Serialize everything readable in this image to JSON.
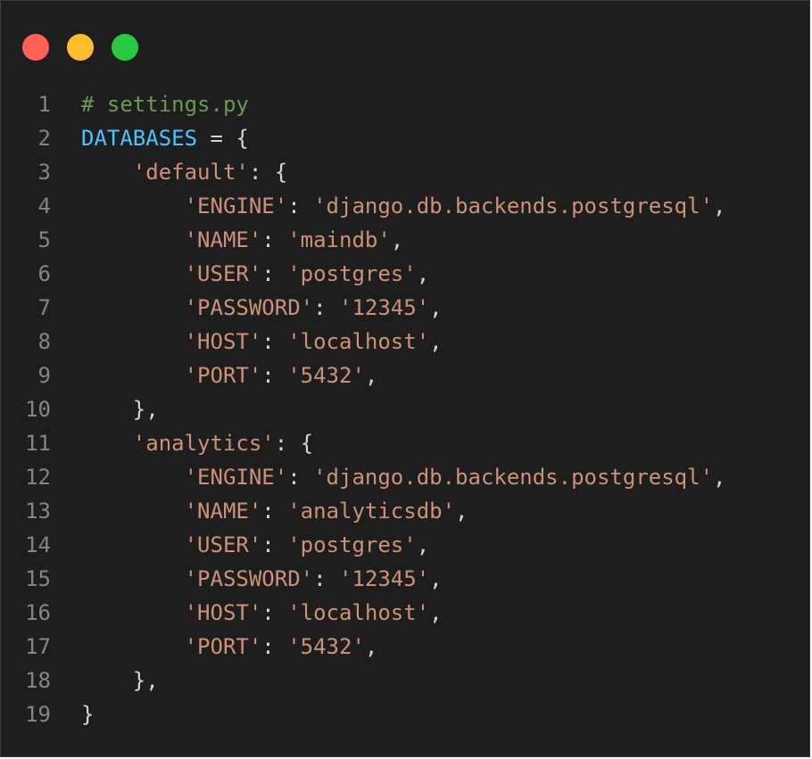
{
  "window": {
    "dots": [
      {
        "name": "close-dot",
        "color": "#ff5f57"
      },
      {
        "name": "minimize-dot",
        "color": "#febc2e"
      },
      {
        "name": "maximize-dot",
        "color": "#28c840"
      }
    ]
  },
  "colors": {
    "background": "#1e1e1e",
    "line_number": "#858585",
    "comment": "#6a9955",
    "variable": "#4fc1ff",
    "string": "#ce9178",
    "punctuation": "#d4d4d4"
  },
  "code": {
    "lines": [
      {
        "number": "1",
        "tokens": [
          {
            "t": "comment",
            "v": "# settings.py"
          }
        ]
      },
      {
        "number": "2",
        "tokens": [
          {
            "t": "var",
            "v": "DATABASES"
          },
          {
            "t": "punct",
            "v": " = {"
          }
        ]
      },
      {
        "number": "3",
        "tokens": [
          {
            "t": "punct",
            "v": "    "
          },
          {
            "t": "str",
            "v": "'default'"
          },
          {
            "t": "punct",
            "v": ": {"
          }
        ]
      },
      {
        "number": "4",
        "tokens": [
          {
            "t": "punct",
            "v": "        "
          },
          {
            "t": "str",
            "v": "'ENGINE'"
          },
          {
            "t": "punct",
            "v": ": "
          },
          {
            "t": "str",
            "v": "'django.db.backends.postgresql'"
          },
          {
            "t": "punct",
            "v": ","
          }
        ]
      },
      {
        "number": "5",
        "tokens": [
          {
            "t": "punct",
            "v": "        "
          },
          {
            "t": "str",
            "v": "'NAME'"
          },
          {
            "t": "punct",
            "v": ": "
          },
          {
            "t": "str",
            "v": "'maindb'"
          },
          {
            "t": "punct",
            "v": ","
          }
        ]
      },
      {
        "number": "6",
        "tokens": [
          {
            "t": "punct",
            "v": "        "
          },
          {
            "t": "str",
            "v": "'USER'"
          },
          {
            "t": "punct",
            "v": ": "
          },
          {
            "t": "str",
            "v": "'postgres'"
          },
          {
            "t": "punct",
            "v": ","
          }
        ]
      },
      {
        "number": "7",
        "tokens": [
          {
            "t": "punct",
            "v": "        "
          },
          {
            "t": "str",
            "v": "'PASSWORD'"
          },
          {
            "t": "punct",
            "v": ": "
          },
          {
            "t": "str",
            "v": "'12345'"
          },
          {
            "t": "punct",
            "v": ","
          }
        ]
      },
      {
        "number": "8",
        "tokens": [
          {
            "t": "punct",
            "v": "        "
          },
          {
            "t": "str",
            "v": "'HOST'"
          },
          {
            "t": "punct",
            "v": ": "
          },
          {
            "t": "str",
            "v": "'localhost'"
          },
          {
            "t": "punct",
            "v": ","
          }
        ]
      },
      {
        "number": "9",
        "tokens": [
          {
            "t": "punct",
            "v": "        "
          },
          {
            "t": "str",
            "v": "'PORT'"
          },
          {
            "t": "punct",
            "v": ": "
          },
          {
            "t": "str",
            "v": "'5432'"
          },
          {
            "t": "punct",
            "v": ","
          }
        ]
      },
      {
        "number": "10",
        "tokens": [
          {
            "t": "punct",
            "v": "    },"
          }
        ]
      },
      {
        "number": "11",
        "tokens": [
          {
            "t": "punct",
            "v": "    "
          },
          {
            "t": "str",
            "v": "'analytics'"
          },
          {
            "t": "punct",
            "v": ": {"
          }
        ]
      },
      {
        "number": "12",
        "tokens": [
          {
            "t": "punct",
            "v": "        "
          },
          {
            "t": "str",
            "v": "'ENGINE'"
          },
          {
            "t": "punct",
            "v": ": "
          },
          {
            "t": "str",
            "v": "'django.db.backends.postgresql'"
          },
          {
            "t": "punct",
            "v": ","
          }
        ]
      },
      {
        "number": "13",
        "tokens": [
          {
            "t": "punct",
            "v": "        "
          },
          {
            "t": "str",
            "v": "'NAME'"
          },
          {
            "t": "punct",
            "v": ": "
          },
          {
            "t": "str",
            "v": "'analyticsdb'"
          },
          {
            "t": "punct",
            "v": ","
          }
        ]
      },
      {
        "number": "14",
        "tokens": [
          {
            "t": "punct",
            "v": "        "
          },
          {
            "t": "str",
            "v": "'USER'"
          },
          {
            "t": "punct",
            "v": ": "
          },
          {
            "t": "str",
            "v": "'postgres'"
          },
          {
            "t": "punct",
            "v": ","
          }
        ]
      },
      {
        "number": "15",
        "tokens": [
          {
            "t": "punct",
            "v": "        "
          },
          {
            "t": "str",
            "v": "'PASSWORD'"
          },
          {
            "t": "punct",
            "v": ": "
          },
          {
            "t": "str",
            "v": "'12345'"
          },
          {
            "t": "punct",
            "v": ","
          }
        ]
      },
      {
        "number": "16",
        "tokens": [
          {
            "t": "punct",
            "v": "        "
          },
          {
            "t": "str",
            "v": "'HOST'"
          },
          {
            "t": "punct",
            "v": ": "
          },
          {
            "t": "str",
            "v": "'localhost'"
          },
          {
            "t": "punct",
            "v": ","
          }
        ]
      },
      {
        "number": "17",
        "tokens": [
          {
            "t": "punct",
            "v": "        "
          },
          {
            "t": "str",
            "v": "'PORT'"
          },
          {
            "t": "punct",
            "v": ": "
          },
          {
            "t": "str",
            "v": "'5432'"
          },
          {
            "t": "punct",
            "v": ","
          }
        ]
      },
      {
        "number": "18",
        "tokens": [
          {
            "t": "punct",
            "v": "    },"
          }
        ]
      },
      {
        "number": "19",
        "tokens": [
          {
            "t": "punct",
            "v": "}"
          }
        ]
      }
    ]
  }
}
